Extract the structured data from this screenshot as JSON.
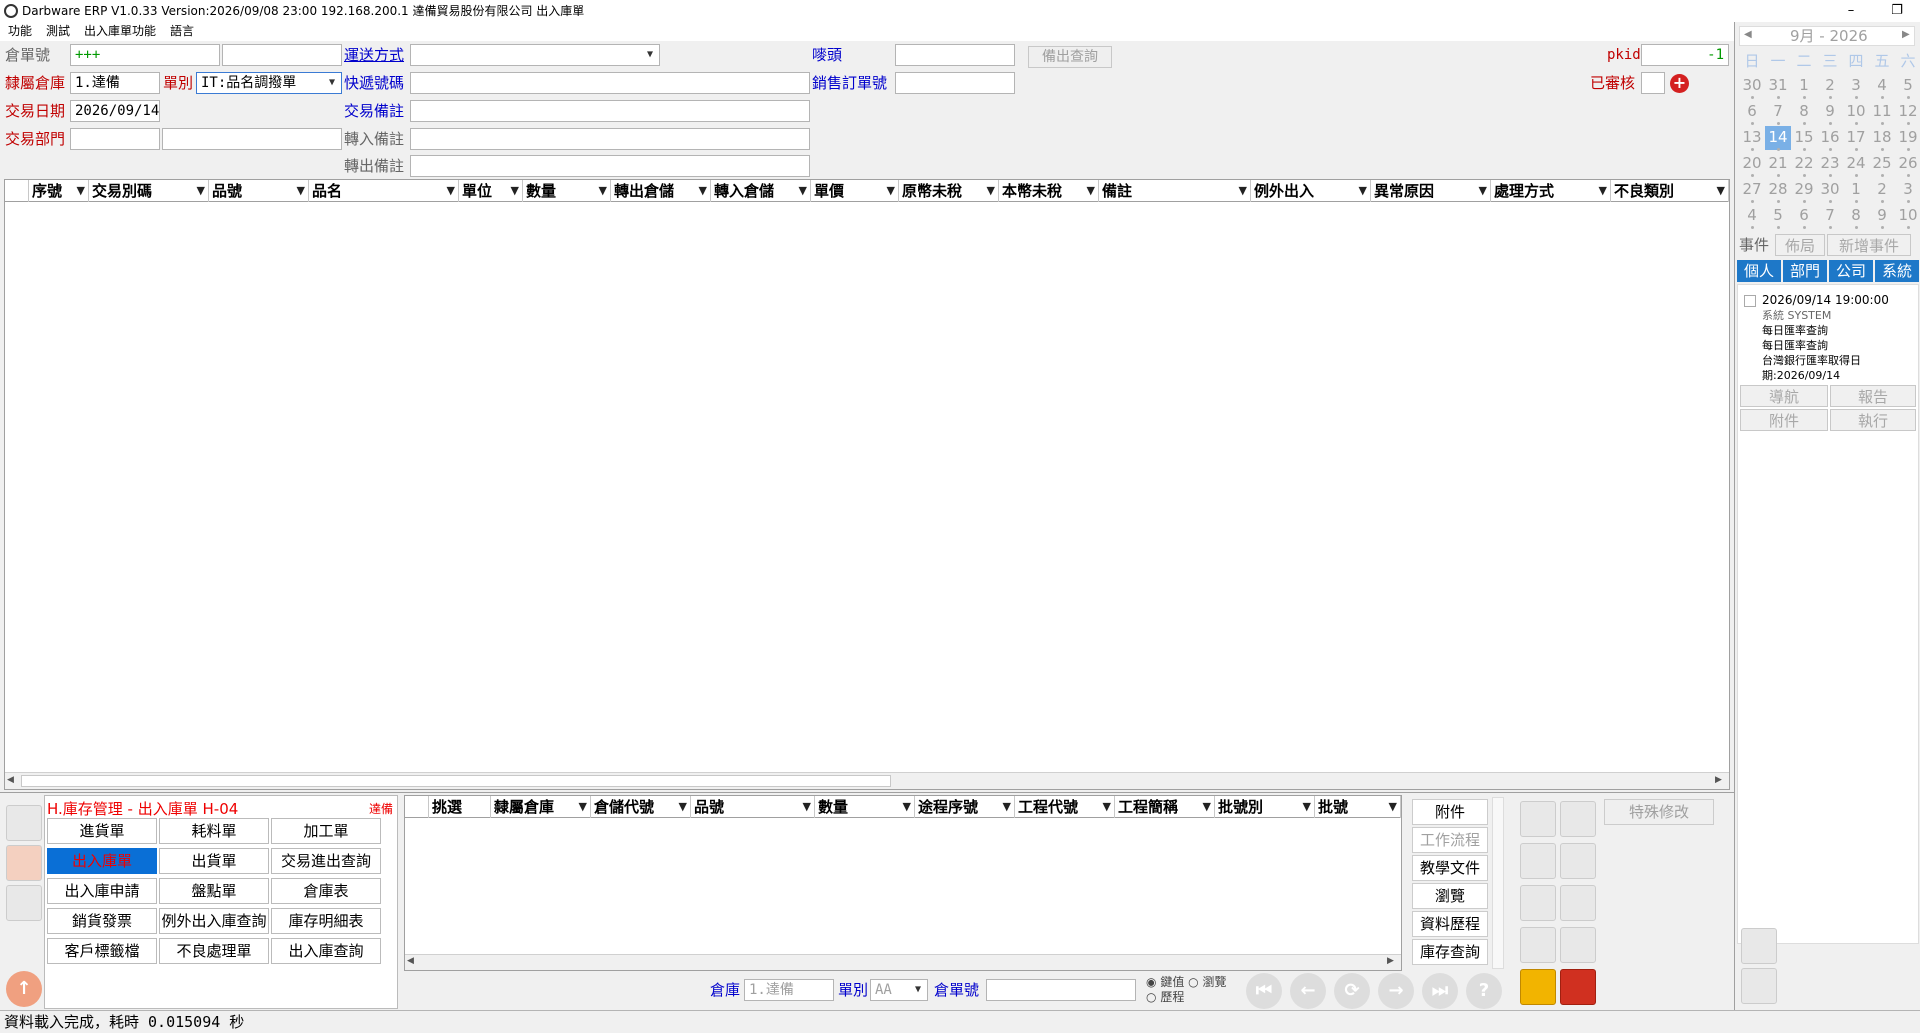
{
  "titlebar": {
    "title": "Darbware ERP V1.0.33 Version:2026/09/08 23:00   192.168.200.1 達備貿易股份有限公司 出入庫單",
    "min": "–",
    "max": "❐",
    "close": "✕"
  },
  "menu": [
    "功能",
    "測試",
    "出入庫單功能",
    "語言"
  ],
  "form": {
    "warehouse_no_label": "倉單號",
    "warehouse_no_value": "+++",
    "belong_warehouse_label": "隸屬倉庫",
    "belong_warehouse_value": "1.達備",
    "doc_type_label": "單別",
    "doc_type_value": "IT:品名調撥單",
    "trade_date_label": "交易日期",
    "trade_date_value": "2026/09/14",
    "trade_dept_label": "交易部門",
    "ship_method_label": "運送方式",
    "express_no_label": "快遞號碼",
    "trade_note_label": "交易備註",
    "transfer_in_note_label": "轉入備註",
    "transfer_out_note_label": "轉出備註",
    "mark_label": "嘜頭",
    "sales_order_label": "銷售訂單號",
    "stock_query_button": "備出查詢",
    "pkid_label": "pkid",
    "pkid_value": "-1",
    "approved_label": "已審核"
  },
  "main_grid": {
    "columns": [
      "序號",
      "交易別碼",
      "品號",
      "品名",
      "單位",
      "數量",
      "轉出倉儲",
      "轉入倉儲",
      "單價",
      "原幣未稅",
      "本幣未稅",
      "備註",
      "例外出入",
      "異常原因",
      "處理方式",
      "不良類別"
    ]
  },
  "module_panel": {
    "title": "H.庫存管理 - 出入庫單  H-04",
    "user": "達備",
    "buttons": [
      "進貨單",
      "耗料單",
      "加工單",
      "出入庫單",
      "出貨單",
      "交易進出查詢",
      "出入庫申請",
      "盤點單",
      "倉庫表",
      "銷貨發票",
      "例外出入庫查詢",
      "庫存明細表",
      "客戶標籤檔",
      "不良處理單",
      "出入庫查詢"
    ],
    "selected": "出入庫單"
  },
  "sub_grid": {
    "columns": [
      "挑選",
      "隸屬倉庫",
      "倉儲代號",
      "品號",
      "數量",
      "途程序號",
      "工程代號",
      "工程簡稱",
      "批號別",
      "批號"
    ]
  },
  "side_buttons": [
    "附件",
    "工作流程",
    "教學文件",
    "瀏覽",
    "資料歷程",
    "庫存查詢"
  ],
  "special_edit_button": "特殊修改",
  "query_bar": {
    "warehouse_label": "倉庫",
    "warehouse_value": "1.達備",
    "doc_type_label": "單別",
    "doc_type_value": "AA",
    "doc_no_label": "倉單號",
    "radio_key": "鍵值",
    "radio_browse": "瀏覽",
    "radio_history": "歷程"
  },
  "statusbar": {
    "text": "資料載入完成，耗時 0.015094 秒"
  },
  "calendar": {
    "month_label": "9月 - 2026",
    "dow": [
      "日",
      "一",
      "二",
      "三",
      "四",
      "五",
      "六"
    ],
    "weeks": [
      [
        "30",
        "31",
        "1",
        "2",
        "3",
        "4",
        "5"
      ],
      [
        "6",
        "7",
        "8",
        "9",
        "10",
        "11",
        "12"
      ],
      [
        "13",
        "14",
        "15",
        "16",
        "17",
        "18",
        "19"
      ],
      [
        "20",
        "21",
        "22",
        "23",
        "24",
        "25",
        "26"
      ],
      [
        "27",
        "28",
        "29",
        "30",
        "1",
        "2",
        "3"
      ],
      [
        "4",
        "5",
        "6",
        "7",
        "8",
        "9",
        "10"
      ]
    ],
    "today": "14"
  },
  "events": {
    "label": "事件",
    "layout_btn": "佈局",
    "add_btn": "新增事件",
    "tabs": [
      "個人",
      "部門",
      "公司",
      "系統"
    ],
    "item": {
      "datetime": "2026/09/14 19:00:00",
      "source": "系統  SYSTEM",
      "title": "每日匯率查詢",
      "desc1": "每日匯率查詢",
      "desc2": "台灣銀行匯率取得日",
      "desc3": "期:2026/09/14"
    },
    "actions": [
      "導航",
      "報告",
      "附件",
      "執行"
    ]
  }
}
